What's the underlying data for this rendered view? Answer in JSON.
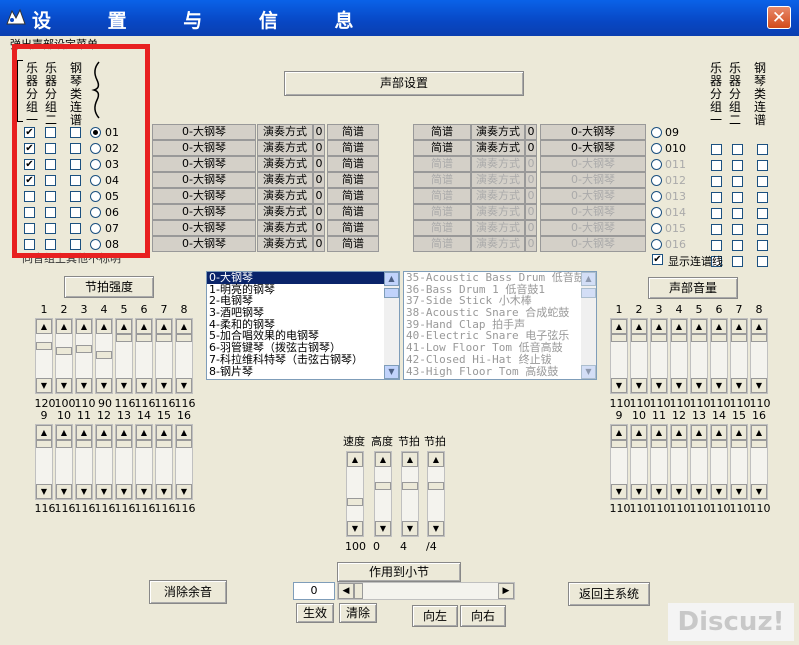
{
  "window": {
    "title": "设 置 与 信 息",
    "menu_hint": "弹出声部设定菜单",
    "close_glyph": "✕"
  },
  "header_button": "声部设置",
  "left_group_headers": [
    "乐器分组一",
    "乐器分组二",
    "钢琴类连谱"
  ],
  "right_group_headers": [
    "乐器分组一",
    "乐器分组二",
    "钢琴类连谱"
  ],
  "left_channels": [
    {
      "num": "01",
      "g1": true,
      "g2": false,
      "g3": false,
      "selected": true,
      "instrument": "0-大钢琴",
      "mode_label": "演奏方式",
      "mode_val": "0",
      "notation": "简谱"
    },
    {
      "num": "02",
      "g1": true,
      "g2": false,
      "g3": false,
      "selected": false,
      "instrument": "0-大钢琴",
      "mode_label": "演奏方式",
      "mode_val": "0",
      "notation": "简谱"
    },
    {
      "num": "03",
      "g1": true,
      "g2": false,
      "g3": false,
      "selected": false,
      "instrument": "0-大钢琴",
      "mode_label": "演奏方式",
      "mode_val": "0",
      "notation": "简谱"
    },
    {
      "num": "04",
      "g1": true,
      "g2": false,
      "g3": false,
      "selected": false,
      "instrument": "0-大钢琴",
      "mode_label": "演奏方式",
      "mode_val": "0",
      "notation": "简谱"
    },
    {
      "num": "05",
      "g1": false,
      "g2": false,
      "g3": false,
      "selected": false,
      "instrument": "0-大钢琴",
      "mode_label": "演奏方式",
      "mode_val": "0",
      "notation": "简谱"
    },
    {
      "num": "06",
      "g1": false,
      "g2": false,
      "g3": false,
      "selected": false,
      "instrument": "0-大钢琴",
      "mode_label": "演奏方式",
      "mode_val": "0",
      "notation": "简谱"
    },
    {
      "num": "07",
      "g1": false,
      "g2": false,
      "g3": false,
      "selected": false,
      "instrument": "0-大钢琴",
      "mode_label": "演奏方式",
      "mode_val": "0",
      "notation": "简谱"
    },
    {
      "num": "08",
      "g1": false,
      "g2": false,
      "g3": false,
      "selected": false,
      "instrument": "0-大钢琴",
      "mode_label": "演奏方式",
      "mode_val": "0",
      "notation": "简谱"
    }
  ],
  "right_channels": [
    {
      "num": "09",
      "enabled": true,
      "notation": "简谱",
      "mode_label": "演奏方式",
      "mode_val": "0",
      "instrument": "0-大钢琴"
    },
    {
      "num": "010",
      "enabled": true,
      "notation": "简谱",
      "mode_label": "演奏方式",
      "mode_val": "0",
      "instrument": "0-大钢琴"
    },
    {
      "num": "011",
      "enabled": false,
      "notation": "简谱",
      "mode_label": "演奏方式",
      "mode_val": "0",
      "instrument": "0-大钢琴"
    },
    {
      "num": "012",
      "enabled": false,
      "notation": "简谱",
      "mode_label": "演奏方式",
      "mode_val": "0",
      "instrument": "0-大钢琴"
    },
    {
      "num": "013",
      "enabled": false,
      "notation": "简谱",
      "mode_label": "演奏方式",
      "mode_val": "0",
      "instrument": "0-大钢琴"
    },
    {
      "num": "014",
      "enabled": false,
      "notation": "简谱",
      "mode_label": "演奏方式",
      "mode_val": "0",
      "instrument": "0-大钢琴"
    },
    {
      "num": "015",
      "enabled": false,
      "notation": "简谱",
      "mode_label": "演奏方式",
      "mode_val": "0",
      "instrument": "0-大钢琴"
    },
    {
      "num": "016",
      "enabled": false,
      "notation": "简谱",
      "mode_label": "演奏方式",
      "mode_val": "0",
      "instrument": "0-大钢琴"
    }
  ],
  "bottom_left_hint": "同音组上其他不标明",
  "show_legato": {
    "label": "显示连谱线",
    "checked": true
  },
  "beat_strength": {
    "button": "节拍强度",
    "top_numbers": [
      "1",
      "2",
      "3",
      "4",
      "5",
      "6",
      "7",
      "8"
    ],
    "top_values": [
      "120",
      "100",
      "110",
      "90",
      "116",
      "116",
      "116",
      "116"
    ],
    "top_levels": [
      0.2,
      0.35,
      0.3,
      0.45,
      0.0,
      0.0,
      0.0,
      0.0
    ],
    "bottom_numbers": [
      "9",
      "10",
      "11",
      "12",
      "13",
      "14",
      "15",
      "16"
    ],
    "bottom_values": [
      "116",
      "116",
      "116",
      "116",
      "116",
      "116",
      "116",
      "116"
    ]
  },
  "instrument_list": [
    "0-大钢琴",
    "1-明亮的钢琴",
    "2-电钢琴",
    "3-酒吧钢琴",
    "4-柔和的钢琴",
    "5-加合唱效果的电钢琴",
    "6-羽管键琴（拨弦古钢琴）",
    "7-科拉维科特琴（击弦古钢琴）",
    "8-钢片琴"
  ],
  "drum_list": [
    "35-Acoustic Bass Drum  低音鼓",
    "36-Bass Drum 1 低音鼓1",
    "37-Side Stick 小木棒",
    "38-Acoustic Snare 合成蛇鼓",
    "39-Hand Clap 拍手声",
    "40-Electric Snare 电子弦乐",
    "41-Low Floor Tom 低音高鼓",
    "42-Closed Hi-Hat 终止钹",
    "43-High Floor Tom 高级鼓"
  ],
  "voice_volume": {
    "button": "声部音量",
    "top_numbers": [
      "1",
      "2",
      "3",
      "4",
      "5",
      "6",
      "7",
      "8"
    ],
    "top_values": [
      "110",
      "110",
      "110",
      "110",
      "110",
      "110",
      "110",
      "110"
    ],
    "bottom_numbers": [
      "9",
      "10",
      "11",
      "12",
      "13",
      "14",
      "15",
      "16"
    ],
    "bottom_values": [
      "110",
      "110",
      "110",
      "110",
      "110",
      "110",
      "110",
      "110"
    ]
  },
  "tempo_panel": {
    "labels": [
      "速度",
      "高度",
      "节拍",
      "节拍"
    ],
    "values": [
      "100",
      "0",
      "4",
      "/4"
    ]
  },
  "measure": {
    "label": "作用到小节",
    "value": "0",
    "apply": "生效",
    "clear": "清除",
    "left": "向左",
    "right": "向右"
  },
  "clear_sound_button": "消除余音",
  "return_button": "返回主系统",
  "watermark": "Discuz!"
}
